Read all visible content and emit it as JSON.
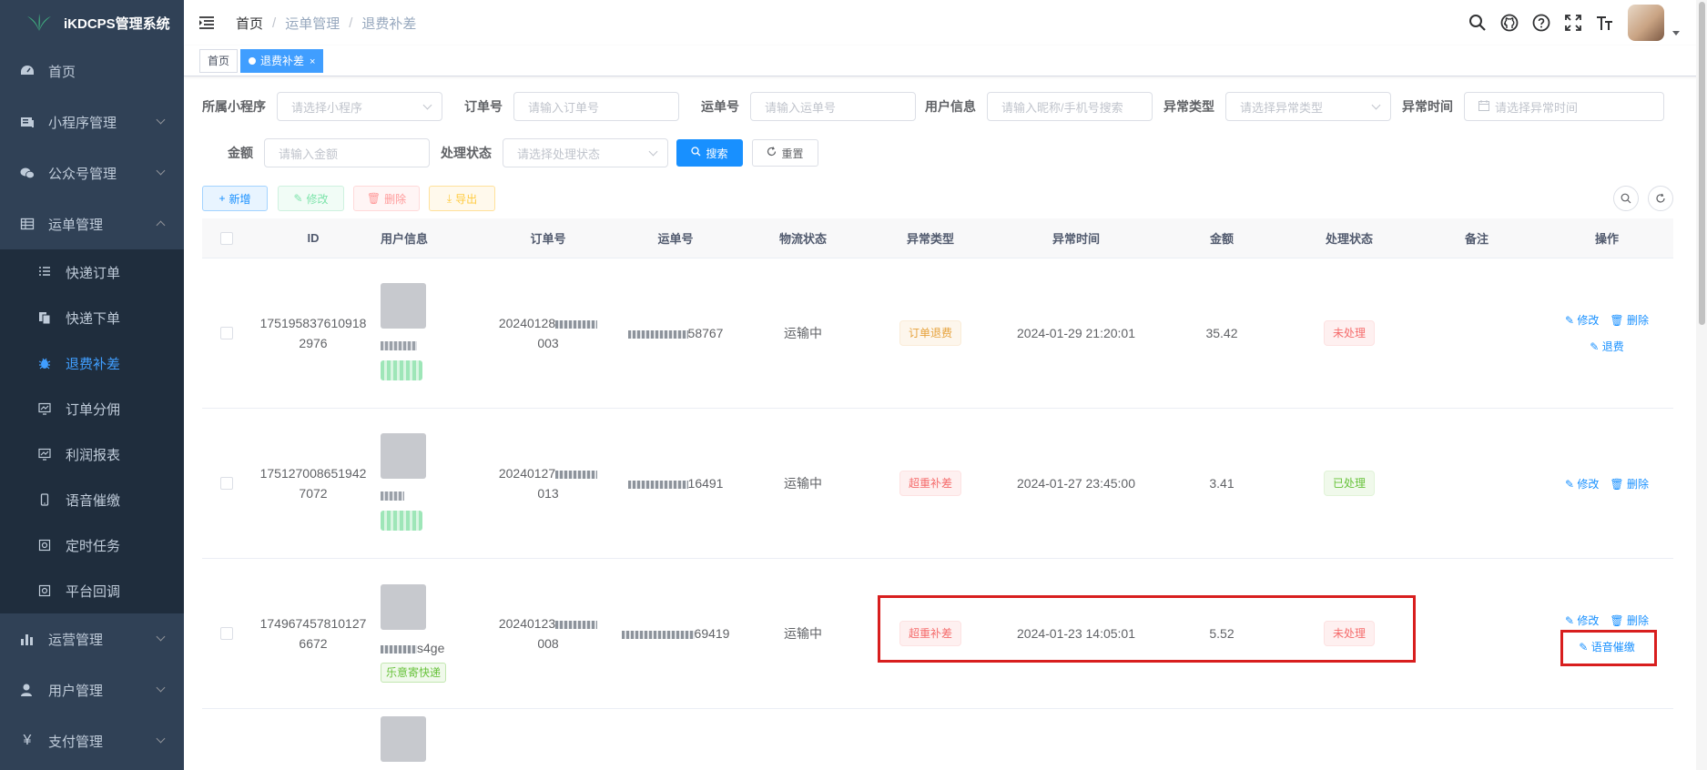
{
  "app": {
    "title": "iKDCPS管理系统"
  },
  "sidebar": {
    "items": [
      {
        "label": "首页",
        "icon": "dashboard-icon"
      },
      {
        "label": "小程序管理",
        "icon": "miniprogram-icon"
      },
      {
        "label": "公众号管理",
        "icon": "wechat-icon"
      },
      {
        "label": "运单管理",
        "icon": "table-icon"
      }
    ],
    "sub_items": [
      {
        "label": "快递订单",
        "icon": "list-icon"
      },
      {
        "label": "快递下单",
        "icon": "copy-icon"
      },
      {
        "label": "退费补差",
        "icon": "bug-icon"
      },
      {
        "label": "订单分佣",
        "icon": "monitor-icon"
      },
      {
        "label": "利润报表",
        "icon": "monitor-icon"
      },
      {
        "label": "语音催缴",
        "icon": "phone-icon"
      },
      {
        "label": "定时任务",
        "icon": "job-icon"
      },
      {
        "label": "平台回调",
        "icon": "job-icon"
      }
    ],
    "bottom_items": [
      {
        "label": "运营管理",
        "icon": "chart-icon"
      },
      {
        "label": "用户管理",
        "icon": "user-icon"
      },
      {
        "label": "支付管理",
        "icon": "yen-icon"
      }
    ]
  },
  "breadcrumb": {
    "home": "首页",
    "parent": "运单管理",
    "current": "退费补差"
  },
  "tags": {
    "home": "首页",
    "current": "退费补差",
    "close": "×"
  },
  "search": {
    "app_label": "所属小程序",
    "app_placeholder": "请选择小程序",
    "order_label": "订单号",
    "order_placeholder": "请输入订单号",
    "waybill_label": "运单号",
    "waybill_placeholder": "请输入运单号",
    "user_label": "用户信息",
    "user_placeholder": "请输入昵称/手机号搜索",
    "exc_label": "异常类型",
    "exc_placeholder": "请选择异常类型",
    "time_label": "异常时间",
    "time_placeholder": "请选择异常时间",
    "amount_label": "金额",
    "amount_placeholder": "请输入金额",
    "status_label": "处理状态",
    "status_placeholder": "请选择处理状态",
    "search_btn": "搜索",
    "reset_btn": "重置"
  },
  "toolbar": {
    "add": "新增",
    "edit": "修改",
    "delete": "删除",
    "export": "导出"
  },
  "table": {
    "headers": [
      "ID",
      "用户信息",
      "订单号",
      "运单号",
      "物流状态",
      "异常类型",
      "异常时间",
      "金额",
      "处理状态",
      "备注",
      "操作"
    ],
    "rows": [
      {
        "id1": "175195837610918",
        "id2": "2976",
        "order1": "20240128",
        "order2": "003",
        "waybill": "58767",
        "logistics": "运输中",
        "exc": "订单退费",
        "time": "2024-01-29 21:20:01",
        "amount": "35.42",
        "status": "未处理",
        "op_edit": "修改",
        "op_del": "删除",
        "op_extra": "退费"
      },
      {
        "id1": "175127008651942",
        "id2": "7072",
        "order1": "20240127",
        "order2": "013",
        "waybill": "16491",
        "logistics": "运输中",
        "exc": "超重补差",
        "time": "2024-01-27 23:45:00",
        "amount": "3.41",
        "status": "已处理",
        "op_edit": "修改",
        "op_del": "删除"
      },
      {
        "id1": "174967457810127",
        "id2": "6672",
        "order1": "20240123",
        "order2": "008",
        "waybill": "69419",
        "logistics": "运输中",
        "exc": "超重补差",
        "time": "2024-01-23 14:05:01",
        "amount": "5.52",
        "status": "未处理",
        "user_suffix": "s4ge",
        "user_tag": "乐意寄快递",
        "op_edit": "修改",
        "op_del": "删除",
        "op_extra": "语音催缴"
      }
    ]
  },
  "colors": {
    "sidebar": "#304156",
    "accent": "#1890ff",
    "highlight": "#d81e1e"
  }
}
